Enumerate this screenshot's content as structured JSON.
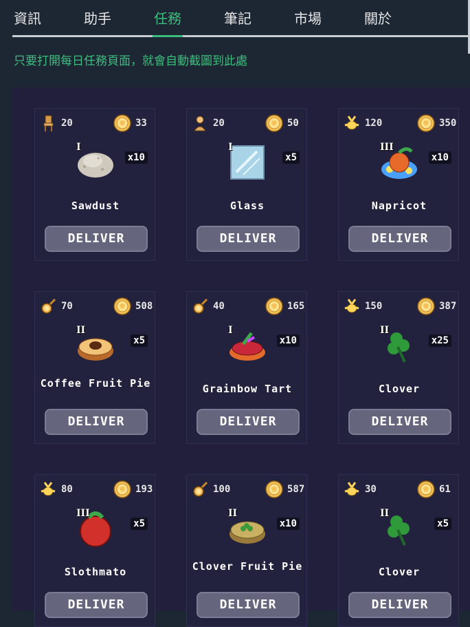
{
  "nav": {
    "tabs": [
      {
        "label": "資訊"
      },
      {
        "label": "助手"
      },
      {
        "label": "任務"
      },
      {
        "label": "筆記"
      },
      {
        "label": "市場"
      },
      {
        "label": "關於"
      }
    ],
    "active": "任務"
  },
  "hint": "只要打開每日任務頁面，就會自動截圖到此處",
  "cards": [
    {
      "req_icon": "chair-icon",
      "req": "20",
      "coins": "33",
      "tier": "I",
      "qty": "x10",
      "name": "Sawdust",
      "deliver": "DELIVER",
      "item_icon": "sawdust-icon"
    },
    {
      "req_icon": "bust-icon",
      "req": "20",
      "coins": "50",
      "tier": "I",
      "qty": "x5",
      "name": "Glass",
      "deliver": "DELIVER",
      "item_icon": "glass-icon"
    },
    {
      "req_icon": "sprout-icon",
      "req": "120",
      "coins": "350",
      "tier": "III",
      "qty": "x10",
      "name": "Napricot",
      "deliver": "DELIVER",
      "item_icon": "napricot-icon"
    },
    {
      "req_icon": "pan-icon",
      "req": "70",
      "coins": "508",
      "tier": "II",
      "qty": "x5",
      "name": "Coffee Fruit Pie",
      "deliver": "DELIVER",
      "item_icon": "coffee-fruit-pie-icon"
    },
    {
      "req_icon": "pan-icon",
      "req": "40",
      "coins": "165",
      "tier": "I",
      "qty": "x10",
      "name": "Grainbow Tart",
      "deliver": "DELIVER",
      "item_icon": "grainbow-tart-icon"
    },
    {
      "req_icon": "sprout-icon",
      "req": "150",
      "coins": "387",
      "tier": "II",
      "qty": "x25",
      "name": "Clover",
      "deliver": "DELIVER",
      "item_icon": "clover-icon"
    },
    {
      "req_icon": "sprout-icon",
      "req": "80",
      "coins": "193",
      "tier": "III",
      "qty": "x5",
      "name": "Slothmato",
      "deliver": "DELIVER",
      "item_icon": "slothmato-icon"
    },
    {
      "req_icon": "pan-icon",
      "req": "100",
      "coins": "587",
      "tier": "II",
      "qty": "x10",
      "name": "Clover Fruit Pie",
      "deliver": "DELIVER",
      "item_icon": "clover-fruit-pie-icon"
    },
    {
      "req_icon": "sprout-icon",
      "req": "30",
      "coins": "61",
      "tier": "II",
      "qty": "x5",
      "name": "Clover",
      "deliver": "DELIVER",
      "item_icon": "clover-icon"
    }
  ]
}
